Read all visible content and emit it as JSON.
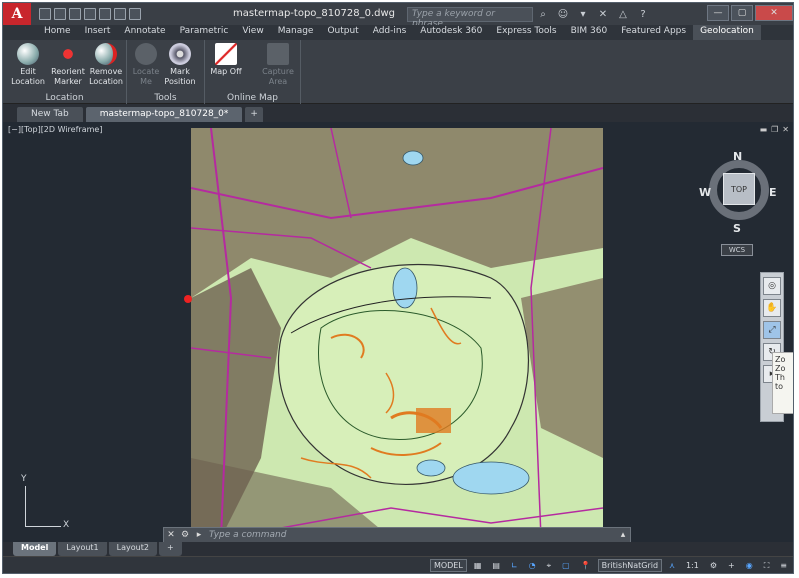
{
  "app": {
    "title": "mastermap-topo_810728_0.dwg",
    "logo": "A"
  },
  "search": {
    "placeholder": "Type a keyword or phrase"
  },
  "ribbon_tabs": [
    "Home",
    "Insert",
    "Annotate",
    "Parametric",
    "View",
    "Manage",
    "Output",
    "Add-ins",
    "Autodesk 360",
    "Express Tools",
    "BIM 360",
    "Featured Apps",
    "Geolocation"
  ],
  "active_tab": "Geolocation",
  "ribbon": {
    "groups": [
      {
        "label": "Location",
        "buttons": [
          {
            "label": "Edit\nLocation",
            "icon": "globe-icon"
          },
          {
            "label": "Reorient\nMarker",
            "icon": "marker-icon"
          },
          {
            "label": "Remove\nLocation",
            "icon": "remove-globe-icon"
          }
        ]
      },
      {
        "label": "Tools",
        "buttons": [
          {
            "label": "Locate\nMe",
            "icon": "locate-icon",
            "disabled": true
          },
          {
            "label": "Mark\nPosition",
            "icon": "crosshair-icon"
          }
        ]
      },
      {
        "label": "Online Map",
        "buttons": [
          {
            "label": "Map Off",
            "icon": "map-icon"
          },
          {
            "label": "Capture\nArea",
            "icon": "capture-icon",
            "disabled": true
          }
        ]
      }
    ]
  },
  "file_tabs": [
    {
      "label": "New Tab",
      "active": false
    },
    {
      "label": "mastermap-topo_810728_0*",
      "active": true
    }
  ],
  "viewport": {
    "label": "[−][Top][2D Wireframe]"
  },
  "viewcube": {
    "n": "N",
    "s": "S",
    "e": "E",
    "w": "W",
    "face": "TOP",
    "wcs": "WCS"
  },
  "ucs": {
    "x": "X",
    "y": "Y"
  },
  "command": {
    "placeholder": "Type a command"
  },
  "tooltip": {
    "lines": [
      "Zo",
      "Zo",
      "Th",
      "to"
    ]
  },
  "layout_tabs": [
    {
      "label": "Model",
      "active": true
    },
    {
      "label": "Layout1",
      "active": false
    },
    {
      "label": "Layout2",
      "active": false
    }
  ],
  "status": {
    "model": "MODEL",
    "coord_system": "BritishNatGrid",
    "scale": "1:1"
  },
  "colors": {
    "accent": "#c8262c",
    "map_bg": "#cde8b0",
    "water": "#9fd7f0",
    "roads": "#b52aa0",
    "contours": "#e07b20"
  }
}
